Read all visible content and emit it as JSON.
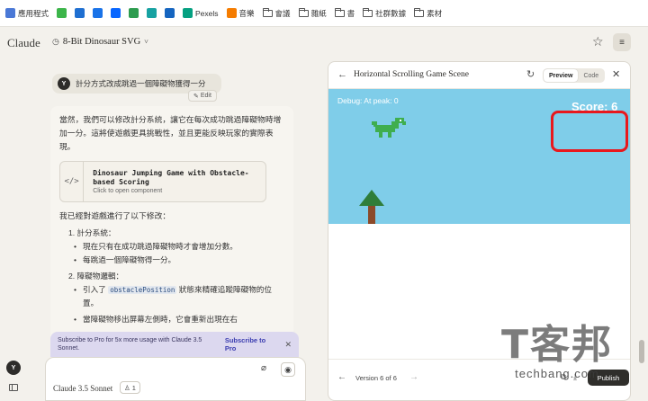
{
  "bookmarks": [
    {
      "label": "應用程式",
      "color": "#4a78d6"
    },
    {
      "label": "",
      "color": "#3cb54a"
    },
    {
      "label": "",
      "color": "#1f6fd1"
    },
    {
      "label": "",
      "color": "#1a73e8"
    },
    {
      "label": "",
      "color": "#0866ff"
    },
    {
      "label": "",
      "color": "#2d9c4f"
    },
    {
      "label": "",
      "color": "#17a2a2"
    },
    {
      "label": "",
      "color": "#1565c0"
    },
    {
      "label": "Pexels",
      "color": "#05a081"
    },
    {
      "label": "音樂",
      "color": "#f57c00"
    },
    {
      "label": "會議",
      "color": ""
    },
    {
      "label": "雜紙",
      "color": ""
    },
    {
      "label": "書",
      "color": ""
    },
    {
      "label": "社群數據",
      "color": ""
    },
    {
      "label": "素材",
      "color": ""
    }
  ],
  "app": {
    "logo": "Claude",
    "chat_title": "8-Bit Dinosaur SVG",
    "chat_title_chevron": "˅"
  },
  "user_message": {
    "avatar": "Y",
    "text": "計分方式改成跳過一個障礙物獲得一分",
    "edit_label": "Edit"
  },
  "assistant": {
    "intro": "當然，我們可以修改計分系統，讓它在每次成功跳過障礙物時增加一分。這將使遊戲更具挑戰性，並且更能反映玩家的實際表現。",
    "artifact_title": "Dinosaur Jumping Game with Obstacle-based Scoring",
    "artifact_sub": "Click to open component",
    "artifact_icon": "</>",
    "changes_intro": "我已經對遊戲進行了以下修改：",
    "item1": "1. 計分系統：",
    "item1_b1": "現在只有在成功跳過障礙物時才會增加分數。",
    "item1_b2": "每跳過一個障礙物得一分。",
    "item2": "2. 障礙物邏輯：",
    "item2_b1_pre": "引入了",
    "item2_b1_code": "obstaclePosition",
    "item2_b1_post": "狀態來精確追蹤障礙物的位置。",
    "item2_b2": "當障礙物移出屏幕左側時，它會重新出現在右"
  },
  "pro_banner": {
    "text": "Subscribe to Pro for 5x more usage with Claude 3.5 Sonnet.",
    "link": "Subscribe to Pro",
    "close": "✕"
  },
  "composer": {
    "model_label": "Claude 3.5 Sonnet",
    "badge": "1"
  },
  "left_avatar": "Y",
  "artifact_panel": {
    "title": "Horizontal Scrolling Game Scene",
    "toggle_preview": "Preview",
    "toggle_code": "Code",
    "debug": "Debug: At peak: 0",
    "score": "Score: 6",
    "version": "Version 6 of 6",
    "publish": "Publish",
    "sky_color": "#7fcde9",
    "dino_color": "#3fae4f",
    "trunk_color": "#8b4a2a",
    "leaf_color": "#2f7d3a",
    "highlight_color": "#e8181d"
  },
  "watermark": {
    "big": "T客邦",
    "small": "techbang.com"
  }
}
